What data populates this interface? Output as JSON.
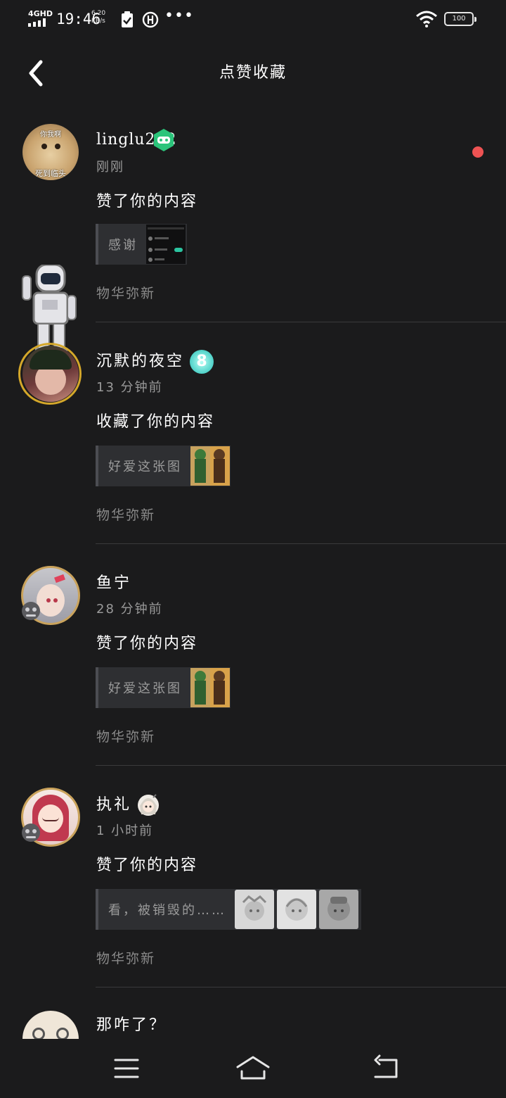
{
  "status_bar": {
    "network": "4GHD",
    "time": "19:46",
    "speed_value": "6.20",
    "speed_unit": "KB/s",
    "battery": "100",
    "icons": [
      "signal-icon",
      "clipboard-check-icon",
      "data-saver-icon",
      "more-dots-icon",
      "wifi-icon",
      "battery-icon"
    ]
  },
  "header": {
    "title": "点赞收藏",
    "back_icon": "chevron-left-icon"
  },
  "notifications": [
    {
      "username": "linglu222",
      "badge_icon": "game-controller-badge-icon",
      "badge_color": "#2bc47a",
      "avatar_text_top": "你我啊",
      "avatar_text_bottom": "死到临头",
      "time": "刚刚",
      "action": "赞了你的内容",
      "preview_text": "感谢",
      "source": "物华弥新",
      "unread": true
    },
    {
      "username": "沉默的夜空",
      "badge_icon": "level-8-badge-icon",
      "badge_color": "#4fd1c8",
      "badge_text": "8",
      "time": "13 分钟前",
      "action": "收藏了你的内容",
      "preview_text": "好爱这张图",
      "source": "物华弥新",
      "unread": false
    },
    {
      "username": "鱼宁",
      "time": "28 分钟前",
      "action": "赞了你的内容",
      "preview_text": "好爱这张图",
      "source": "物华弥新",
      "unread": false
    },
    {
      "username": "执礼",
      "badge_icon": "anime-girl-badge-icon",
      "time": "1 小时前",
      "action": "赞了你的内容",
      "preview_text": "看，被销毁的……",
      "source": "物华弥新",
      "unread": false
    },
    {
      "username": "那咋了？",
      "unread": false
    }
  ],
  "colors": {
    "background": "#1b1b1c",
    "unread_dot": "#ee5353",
    "secondary_text": "#9a9a9a",
    "avatar_frame": "#caa35c"
  },
  "nav_bar": {
    "menu_icon": "menu-lines-icon",
    "home_icon": "home-icon",
    "back_icon": "back-arrow-icon"
  }
}
